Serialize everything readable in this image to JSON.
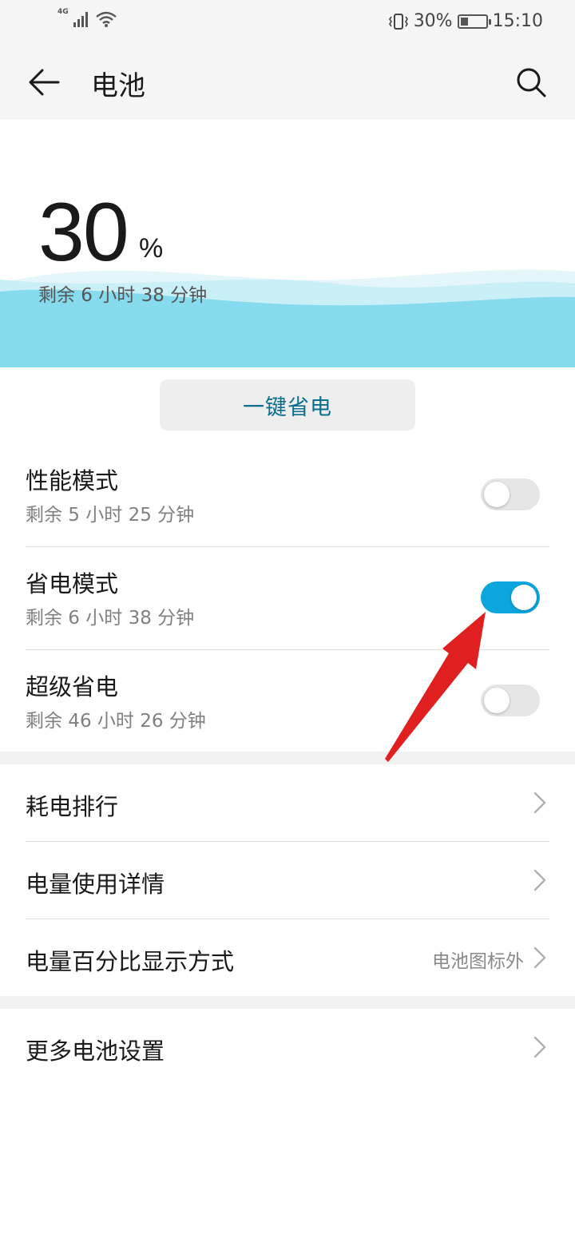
{
  "status_bar": {
    "network_label": "4G",
    "battery_percent": "30%",
    "time": "15:10"
  },
  "app_bar": {
    "title": "电池"
  },
  "hero": {
    "percent_value": "30",
    "percent_sign": "%",
    "remaining": "剩余 6 小时 38 分钟"
  },
  "one_key_button": "一键省电",
  "modes": [
    {
      "title": "性能模式",
      "remaining": "剩余 5 小时 25 分钟",
      "enabled": false
    },
    {
      "title": "省电模式",
      "remaining": "剩余 6 小时 38 分钟",
      "enabled": true
    },
    {
      "title": "超级省电",
      "remaining": "剩余 46 小时 26 分钟",
      "enabled": false
    }
  ],
  "nav_items": [
    {
      "label": "耗电排行",
      "value": ""
    },
    {
      "label": "电量使用详情",
      "value": ""
    },
    {
      "label": "电量百分比显示方式",
      "value": "电池图标外"
    }
  ],
  "more_settings": {
    "label": "更多电池设置"
  },
  "colors": {
    "accent_toggle": "#0aa6dc",
    "button_text": "#0a6f8e",
    "wave_main": "#86dbee",
    "annotation_arrow": "#e02020"
  }
}
